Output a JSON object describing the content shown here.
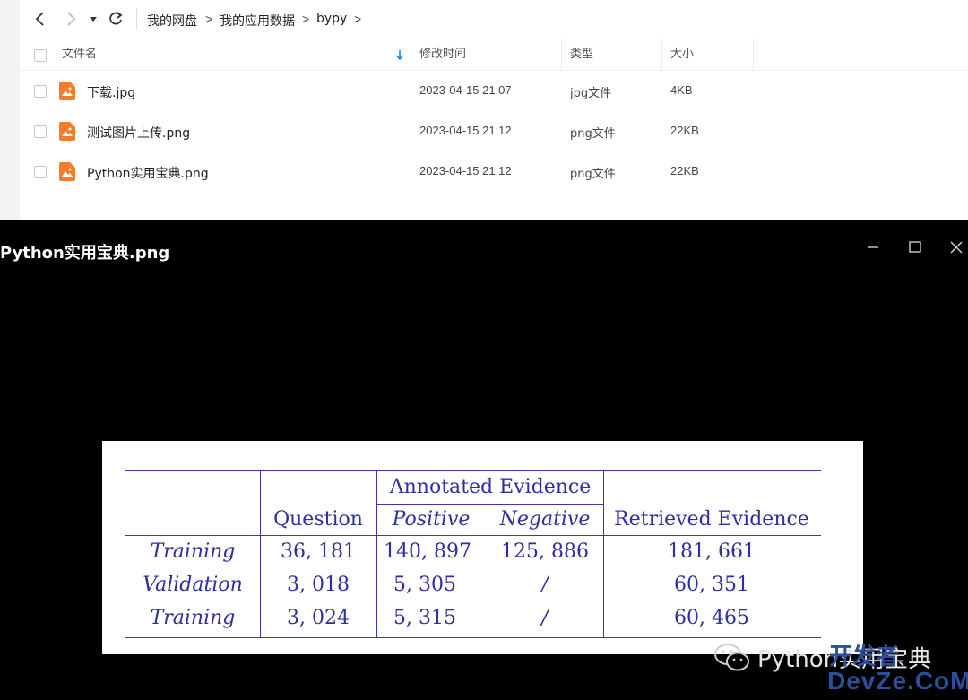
{
  "breadcrumb": [
    "我的网盘",
    "我的应用数据",
    "bypy"
  ],
  "breadcrumb_separator": ">",
  "toolbar_icons": [
    "back-arrow-icon",
    "forward-arrow-icon",
    "dropdown-icon",
    "refresh-icon"
  ],
  "columns": {
    "name": "文件名",
    "modified": "修改时间",
    "type": "类型",
    "size": "大小"
  },
  "files": [
    {
      "name": "下载.jpg",
      "modified": "2023-04-15 21:07",
      "type": "jpg文件",
      "size": "4KB"
    },
    {
      "name": "测试图片上传.png",
      "modified": "2023-04-15 21:12",
      "type": "png文件",
      "size": "22KB"
    },
    {
      "name": "Python实用宝典.png",
      "modified": "2023-04-15 21:12",
      "type": "png文件",
      "size": "22KB"
    }
  ],
  "viewer": {
    "title": "Python实用宝典.png",
    "window_controls": [
      "minimize-icon",
      "maximize-icon",
      "close-icon"
    ]
  },
  "image_table": {
    "group_header": "Annotated Evidence",
    "headers": [
      "Question",
      "Positive",
      "Negative",
      "Retrieved Evidence"
    ],
    "rows": [
      {
        "label": "Training",
        "question": "36, 181",
        "positive": "140, 897",
        "negative": "125, 886",
        "retrieved": "181, 661"
      },
      {
        "label": "Validation",
        "question": "3, 018",
        "positive": "5, 305",
        "negative": "/",
        "retrieved": "60, 351"
      },
      {
        "label": "Training",
        "question": "3, 024",
        "positive": "5, 315",
        "negative": "/",
        "retrieved": "60, 465"
      }
    ]
  },
  "watermark": {
    "text": "Python实用宝典",
    "logo_top": "开发者",
    "logo_bottom": "DevZe.CoM"
  },
  "colors": {
    "file_icon": "#f57c2c",
    "table_ink": "#2f2fa0",
    "logo": "#2d4f9a",
    "sort_arrow": "#1e88e5"
  }
}
